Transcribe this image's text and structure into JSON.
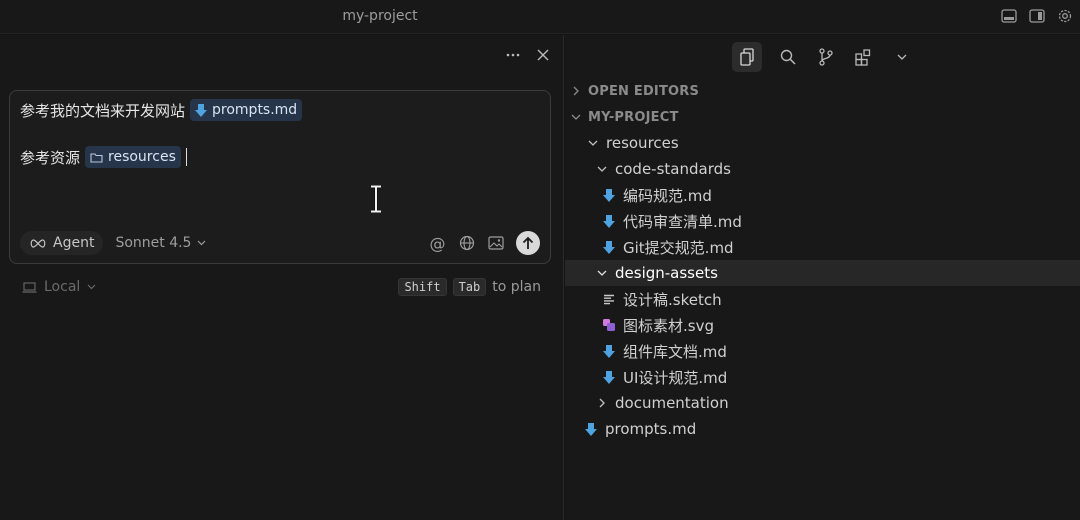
{
  "window": {
    "title": "my-project"
  },
  "composer": {
    "line1_text": "参考我的文档来开发网站",
    "line1_chip": "prompts.md",
    "line2_text": "参考资源",
    "line2_chip": "resources",
    "mode": "Agent",
    "model": "Sonnet 4.5"
  },
  "footer": {
    "env": "Local",
    "key1": "Shift",
    "key2": "Tab",
    "hint": "to plan"
  },
  "explorer": {
    "open_editors": "OPEN EDITORS",
    "project": "MY-PROJECT",
    "tree": [
      {
        "label": "resources",
        "kind": "folder",
        "expanded": true
      },
      {
        "label": "code-standards",
        "kind": "folder",
        "expanded": true
      },
      {
        "label": "编码规范.md",
        "kind": "md"
      },
      {
        "label": "代码审查清单.md",
        "kind": "md"
      },
      {
        "label": "Git提交规范.md",
        "kind": "md"
      },
      {
        "label": "design-assets",
        "kind": "folder",
        "expanded": true,
        "selected": true
      },
      {
        "label": "设计稿.sketch",
        "kind": "sketch"
      },
      {
        "label": "图标素材.svg",
        "kind": "svg"
      },
      {
        "label": "组件库文档.md",
        "kind": "md"
      },
      {
        "label": "UI设计规范.md",
        "kind": "md"
      },
      {
        "label": "documentation",
        "kind": "folder",
        "expanded": false
      },
      {
        "label": "prompts.md",
        "kind": "md"
      }
    ]
  },
  "colors": {
    "background": "#181818",
    "chip_bg": "#26354a",
    "markdown_icon": "#4fa3e0",
    "svg_icon": "#b36bd6",
    "selection": "#272727"
  }
}
